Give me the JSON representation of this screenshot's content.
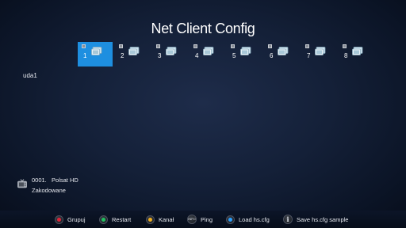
{
  "title": "Net Client Config",
  "slots": [
    {
      "number": "1",
      "selected": true
    },
    {
      "number": "2",
      "selected": false
    },
    {
      "number": "3",
      "selected": false
    },
    {
      "number": "4",
      "selected": false
    },
    {
      "number": "5",
      "selected": false
    },
    {
      "number": "6",
      "selected": false
    },
    {
      "number": "7",
      "selected": false
    },
    {
      "number": "8",
      "selected": false
    }
  ],
  "channel_label": "uda1",
  "channel_info": {
    "line1": "0001.   Polsat HD",
    "line2": "Zakodowane",
    "icon": "tv-icon"
  },
  "footer": {
    "red_label": "Grupuj",
    "green_label": "Restart",
    "yellow_label": "Kanał",
    "info_key_text": "INFO",
    "info_label": "Ping",
    "blue_label": "Load hs.cfg",
    "i_key_text": "i",
    "i_label": "Save hs.cfg sample"
  },
  "colors": {
    "selected_slot": "#1e8fe0",
    "red": "#e0243a",
    "green": "#20c060",
    "yellow": "#f0b020",
    "blue": "#2aa0ff"
  }
}
